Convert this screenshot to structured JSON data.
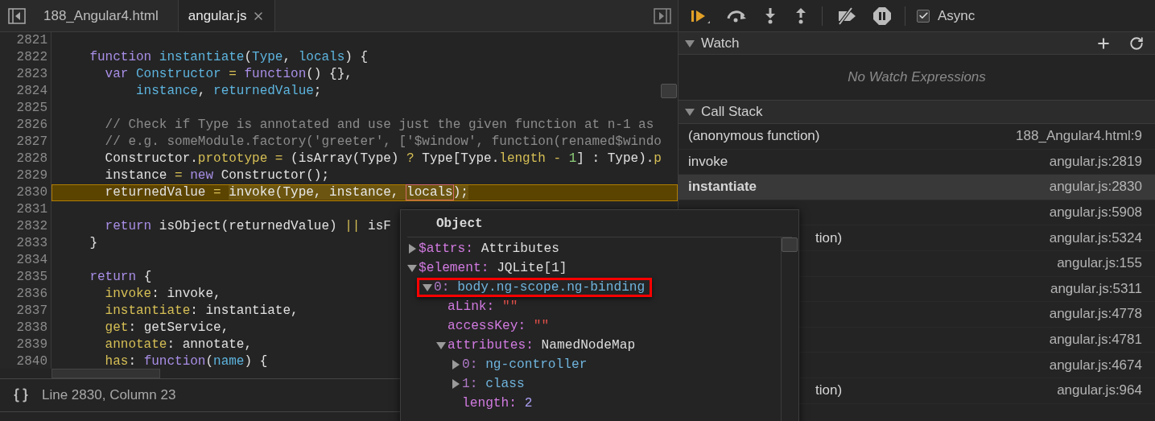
{
  "editor": {
    "tabs": [
      {
        "label": "188_Angular4.html",
        "selected": false,
        "closable": false
      },
      {
        "label": "angular.js",
        "selected": true,
        "closable": true
      }
    ],
    "lines": [
      {
        "number": "2821",
        "current": false
      },
      {
        "number": "2822",
        "current": false,
        "tokens": [
          {
            "kind": "keyword",
            "text": "    function "
          },
          {
            "kind": "def",
            "text": "instantiate"
          },
          {
            "kind": "plain",
            "text": "("
          },
          {
            "kind": "def",
            "text": "Type"
          },
          {
            "kind": "plain",
            "text": ", "
          },
          {
            "kind": "def",
            "text": "locals"
          },
          {
            "kind": "plain",
            "text": ") {"
          }
        ]
      },
      {
        "number": "2823",
        "current": false,
        "tokens": [
          {
            "kind": "keyword",
            "text": "      var "
          },
          {
            "kind": "def",
            "text": "Constructor "
          },
          {
            "kind": "operator",
            "text": "= "
          },
          {
            "kind": "keyword",
            "text": "function"
          },
          {
            "kind": "plain",
            "text": "() {},"
          }
        ]
      },
      {
        "number": "2824",
        "current": false,
        "tokens": [
          {
            "kind": "def",
            "text": "          instance"
          },
          {
            "kind": "plain",
            "text": ", "
          },
          {
            "kind": "def",
            "text": "returnedValue"
          },
          {
            "kind": "plain",
            "text": ";"
          }
        ]
      },
      {
        "number": "2825",
        "current": false
      },
      {
        "number": "2826",
        "current": false,
        "tokens": [
          {
            "kind": "comment",
            "text": "      // Check if Type is annotated and use just the given function at n-1 as"
          }
        ]
      },
      {
        "number": "2827",
        "current": false,
        "tokens": [
          {
            "kind": "comment",
            "text": "      // e.g. someModule.factory('greeter', ['$window', function(renamed$windo"
          }
        ]
      },
      {
        "number": "2828",
        "current": false,
        "tokens": [
          {
            "kind": "plain",
            "text": "      Constructor."
          },
          {
            "kind": "property",
            "text": "prototype "
          },
          {
            "kind": "operator",
            "text": "= "
          },
          {
            "kind": "plain",
            "text": "(isArray(Type) "
          },
          {
            "kind": "operator",
            "text": "? "
          },
          {
            "kind": "plain",
            "text": "Type[Type."
          },
          {
            "kind": "property",
            "text": "length "
          },
          {
            "kind": "operator",
            "text": "- "
          },
          {
            "kind": "number",
            "text": "1"
          },
          {
            "kind": "plain",
            "text": "] : Type)."
          },
          {
            "kind": "property",
            "text": "p"
          }
        ]
      },
      {
        "number": "2829",
        "current": false,
        "tokens": [
          {
            "kind": "plain",
            "text": "      instance "
          },
          {
            "kind": "operator",
            "text": "= "
          },
          {
            "kind": "keyword",
            "text": "new "
          },
          {
            "kind": "plain",
            "text": "Constructor();"
          }
        ]
      },
      {
        "number": "2830",
        "current": true,
        "tokens": [
          {
            "kind": "plain",
            "text": "      returnedValue "
          },
          {
            "kind": "operator",
            "text": "= "
          },
          {
            "kind": "call",
            "text": "invoke(Type, instance, "
          },
          {
            "kind": "hovered",
            "text": "locals"
          },
          {
            "kind": "call",
            "text": ");"
          }
        ]
      },
      {
        "number": "2831",
        "current": false
      },
      {
        "number": "2832",
        "current": false,
        "tokens": [
          {
            "kind": "keyword",
            "text": "      return "
          },
          {
            "kind": "plain",
            "text": "isObject(returnedValue) "
          },
          {
            "kind": "operator",
            "text": "|| "
          },
          {
            "kind": "plain",
            "text": "isF"
          }
        ]
      },
      {
        "number": "2833",
        "current": false,
        "tokens": [
          {
            "kind": "plain",
            "text": "    }"
          }
        ]
      },
      {
        "number": "2834",
        "current": false
      },
      {
        "number": "2835",
        "current": false,
        "tokens": [
          {
            "kind": "keyword",
            "text": "    return "
          },
          {
            "kind": "plain",
            "text": "{"
          }
        ]
      },
      {
        "number": "2836",
        "current": false,
        "tokens": [
          {
            "kind": "property",
            "text": "      invoke"
          },
          {
            "kind": "plain",
            "text": ": invoke,"
          }
        ]
      },
      {
        "number": "2837",
        "current": false,
        "tokens": [
          {
            "kind": "property",
            "text": "      instantiate"
          },
          {
            "kind": "plain",
            "text": ": instantiate,"
          }
        ]
      },
      {
        "number": "2838",
        "current": false,
        "tokens": [
          {
            "kind": "property",
            "text": "      get"
          },
          {
            "kind": "plain",
            "text": ": getService,"
          }
        ]
      },
      {
        "number": "2839",
        "current": false,
        "tokens": [
          {
            "kind": "property",
            "text": "      annotate"
          },
          {
            "kind": "plain",
            "text": ": annotate,"
          }
        ]
      },
      {
        "number": "2840",
        "current": false,
        "tokens": [
          {
            "kind": "property",
            "text": "      has"
          },
          {
            "kind": "plain",
            "text": ": "
          },
          {
            "kind": "keyword",
            "text": "function"
          },
          {
            "kind": "plain",
            "text": "("
          },
          {
            "kind": "def",
            "text": "name"
          },
          {
            "kind": "plain",
            "text": ") {"
          }
        ]
      }
    ],
    "status": "Line 2830, Column 23"
  },
  "debugger": {
    "async": {
      "label": "Async",
      "checked": true
    },
    "watch": {
      "title": "Watch",
      "expanded": true,
      "empty_text": "No Watch Expressions"
    },
    "call_stack": {
      "title": "Call Stack",
      "expanded": true,
      "frames": [
        {
          "name": "(anonymous function)",
          "location": "188_Angular4.html:9",
          "selected": false,
          "clipped": false
        },
        {
          "name": "invoke",
          "location": "angular.js:2819",
          "selected": false,
          "clipped": false
        },
        {
          "name": "instantiate",
          "location": "angular.js:2830",
          "selected": true,
          "clipped": false
        },
        {
          "location": "angular.js:5908",
          "selected": false
        },
        {
          "name": "tion)",
          "location": "angular.js:5324",
          "selected": false,
          "clipped": true
        },
        {
          "location": "angular.js:155",
          "selected": false
        },
        {
          "location": "angular.js:5311",
          "selected": false
        },
        {
          "location": "angular.js:4778",
          "selected": false
        },
        {
          "location": "angular.js:4781",
          "selected": false
        },
        {
          "location": "angular.js:4674",
          "selected": false
        },
        {
          "name": "tion)",
          "location": "angular.js:964",
          "selected": false,
          "clipped": true
        }
      ]
    }
  },
  "popover": {
    "title": "Object",
    "nodes": [
      {
        "key": "$attrs:",
        "value": "Attributes",
        "kind": "object",
        "expanded": false,
        "highlighted": false
      },
      {
        "key": "$element:",
        "value": "JQLite[1]",
        "kind": "object",
        "expanded": true,
        "highlighted": false,
        "children": [
          {
            "key": "0:",
            "value": "body.ng-scope.ng-binding",
            "kind": "node",
            "expanded": true,
            "highlighted": true,
            "children": [
              {
                "key": "aLink:",
                "value": "\"\"",
                "kind": "string",
                "highlighted": false
              },
              {
                "key": "accessKey:",
                "value": "\"\"",
                "kind": "string",
                "highlighted": false
              },
              {
                "key": "attributes:",
                "value": "NamedNodeMap",
                "kind": "object",
                "expanded": true,
                "highlighted": false,
                "children": [
                  {
                    "key": "0:",
                    "value": "ng-controller",
                    "kind": "node",
                    "expanded": false,
                    "highlighted": false
                  },
                  {
                    "key": "1:",
                    "value": "class",
                    "kind": "node",
                    "expanded": false,
                    "highlighted": false
                  },
                  {
                    "key": "length:",
                    "value": "2",
                    "kind": "number",
                    "highlighted": false
                  }
                ]
              }
            ]
          }
        ]
      }
    ]
  }
}
